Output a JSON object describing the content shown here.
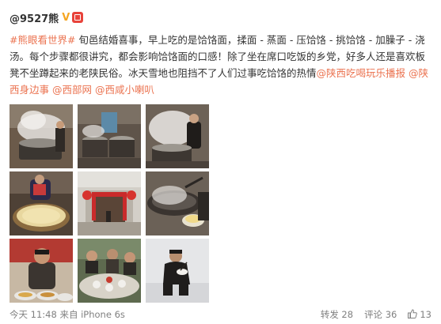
{
  "user": {
    "name": "@9527熊",
    "verified_badge": "V"
  },
  "post": {
    "hashtag": "#熊眼看世界#",
    "body": " 旬邑结婚喜事，早上吃的是饸饹面，揉面 - 蒸面 - 压饸饹 - 挑饸饹 - 加臊子 - 浇汤。每个步骤都很讲究，都会影响饸饹面的口感！除了坐在席口吃饭的乡党，好多人还是喜欢板凳不坐蹲起来的老陕民俗。冰天雪地也阻挡不了人们过事吃饸饹的热情",
    "mentions": [
      "@陕西吃喝玩乐播报",
      "@陕西身边事",
      "@西部网",
      "@西咸小喇叭"
    ]
  },
  "photos": [
    {
      "id": "steaming-pots"
    },
    {
      "id": "kitchen-stoves"
    },
    {
      "id": "cook-steam"
    },
    {
      "id": "noodle-basket"
    },
    {
      "id": "red-lantern-gate"
    },
    {
      "id": "wok-ladle"
    },
    {
      "id": "man-with-noodles"
    },
    {
      "id": "dining-table"
    },
    {
      "id": "squatting-eater"
    }
  ],
  "footer": {
    "time_source": "今天 11:48 来自 iPhone 6s",
    "reposts": "转发 28",
    "comments": "评论 36",
    "likes": "13"
  },
  "colors": {
    "link": "#eb7350",
    "text": "#333333",
    "muted": "#808080",
    "verified": "#f5a623",
    "badge_red": "#e8433b"
  }
}
